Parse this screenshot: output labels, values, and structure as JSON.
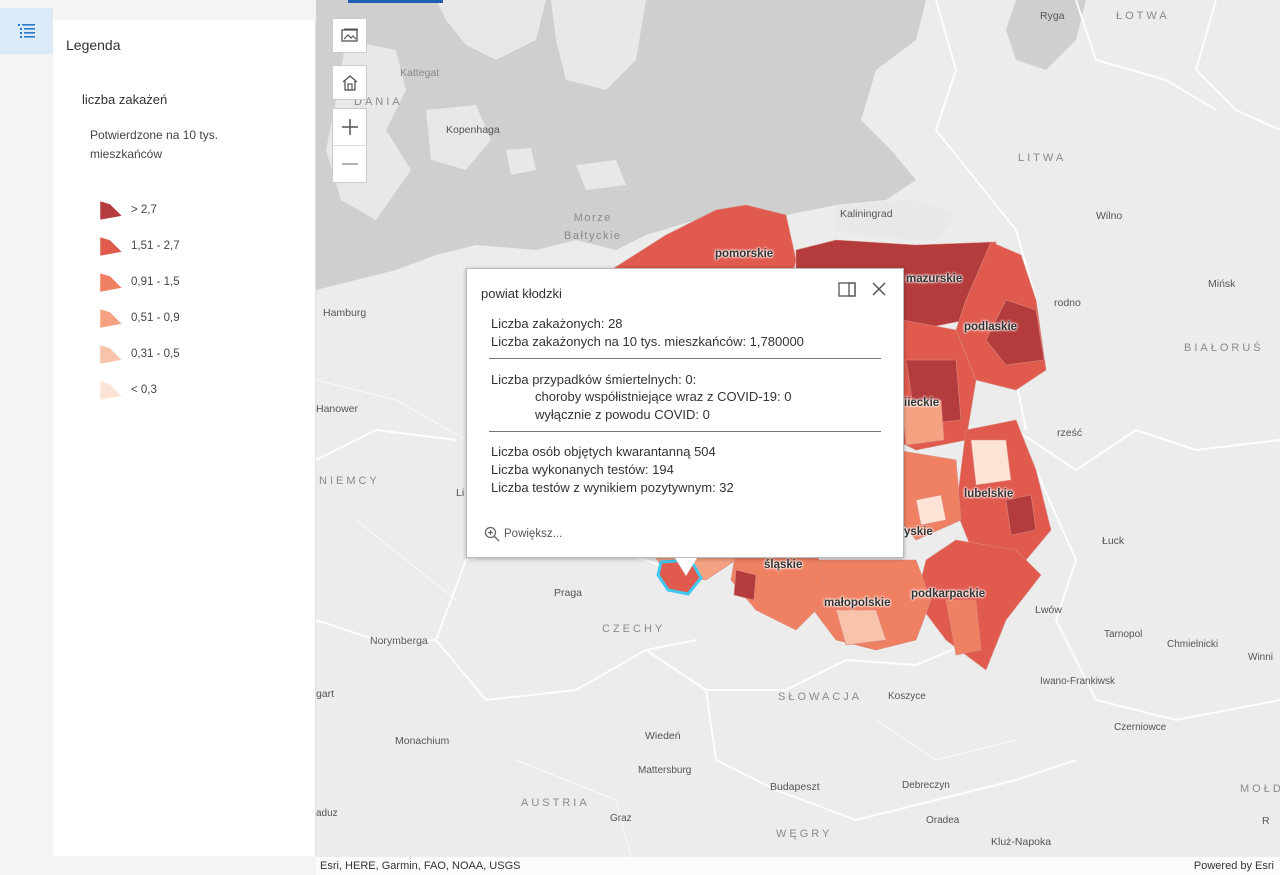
{
  "legend": {
    "title": "Legenda",
    "layer_title": "liczba zakażeń",
    "field_title": "Potwierdzone na 10 tys. mieszkańców",
    "classes": [
      {
        "label": "> 2,7",
        "color": "#b43c3c"
      },
      {
        "label": "1,51 - 2,7",
        "color": "#e05a4e"
      },
      {
        "label": "0,91 - 1,5",
        "color": "#f08062"
      },
      {
        "label": "0,51 - 0,9",
        "color": "#f5a282"
      },
      {
        "label": "0,31 - 0,5",
        "color": "#f9c3ab"
      },
      {
        "label": "< 0,3",
        "color": "#fde2d6"
      }
    ]
  },
  "controls": {
    "legend_icon": "list-icon",
    "basemap_icon": "basemap-gallery-icon",
    "home_icon": "home-icon",
    "zoom_in_icon": "plus-icon",
    "zoom_out_icon": "minus-icon"
  },
  "map_labels": {
    "ryga": "Ryga",
    "lotwa": "ŁOTWA",
    "kattegat": "Kattegat",
    "dania": "DANIA",
    "kopenhaga": "Kopenhaga",
    "litwa": "LITWA",
    "morze_line1": "Morze",
    "morze_line2": "Bałtyckie",
    "kaliningrad": "Kaliningrad",
    "wilno": "Wilno",
    "minsk": "Mińsk",
    "bialorus": "BIAŁORUŚ",
    "hamburg": "Hamburg",
    "grodno": "rodno",
    "hanower": "Hanower",
    "brzesc": "rześć",
    "niemcy": "NIEMCY",
    "li": "Li",
    "luck": "Łuck",
    "praga": "Praga",
    "czechy": "CZECHY",
    "lwow": "Lwów",
    "norymberga": "Norymberga",
    "tarnopol": "Tarnopol",
    "chmielnicki": "Chmielnicki",
    "winnica": "Winni",
    "gart": "gart",
    "iwano": "Iwano-Frankiwsk",
    "slowacja": "SŁOWACJA",
    "koszyce": "Koszyce",
    "czerniowce": "Czerniowce",
    "monachium": "Monachium",
    "wieden": "Wiedeń",
    "mattersburg": "Mattersburg",
    "budapeszt": "Budapeszt",
    "debreczyn": "Debreczyn",
    "austria": "AUSTRIA",
    "moldawia": "MOŁDA",
    "graz": "Graz",
    "wegry": "WĘGRY",
    "oradea": "Oradea",
    "kluz": "Kluż-Napoka",
    "paduz": "aduz",
    "r_edge": "R",
    "pomorskie": "pomorskie",
    "mazurskie": "mazurskie",
    "podlaskie": "podlaskie",
    "mazowieckie": "iieckie",
    "lubelskie": "lubelskie",
    "swietokrzyskie": "yskie",
    "slaskie": "śląskie",
    "malopolskie": "małopolskie",
    "podkarpackie": "podkarpackie"
  },
  "attribution": {
    "left": "Esri, HERE, Garmin, FAO, NOAA, USGS",
    "right": "Powered by Esri"
  },
  "popup": {
    "title": "powiat kłodzki",
    "lines": [
      "Liczba zakażonych: 28",
      "Liczba zakażonych na 10 tys. mieszkańców: 1,780000",
      "Liczba przypadków śmiertelnych: 0:",
      "choroby współistniejące wraz z COVID-19: 0",
      "wyłącznie z powodu COVID: 0",
      "Liczba osób objętych kwarantanną 504",
      "Liczba wykonanych testów: 194",
      "Liczba testów z wynikiem pozytywnym: 32"
    ],
    "zoom_label": "Powiększ..."
  }
}
